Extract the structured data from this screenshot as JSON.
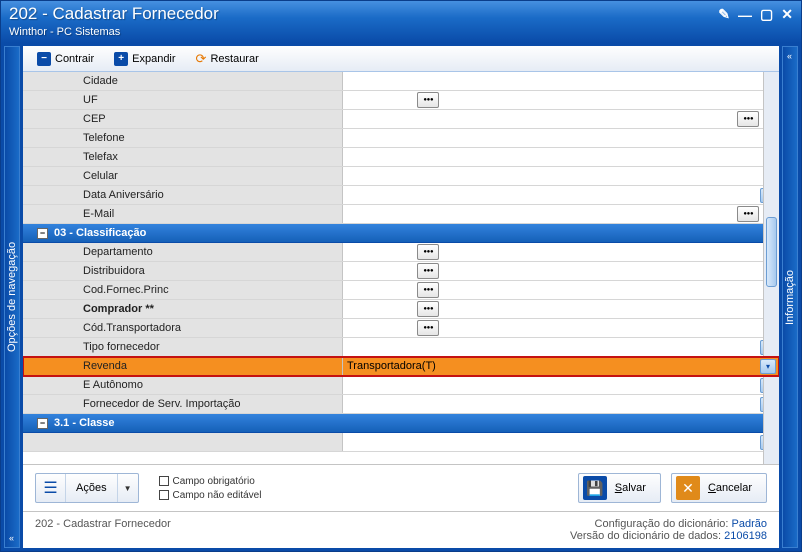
{
  "window": {
    "title": "202 - Cadastrar  Fornecedor",
    "subtitle": "Winthor - PC Sistemas"
  },
  "toolbar": {
    "contrair": "Contrair",
    "expandir": "Expandir",
    "restaurar": "Restaurar"
  },
  "sidebar_left": "Opções de navegação",
  "sidebar_right": "Informação",
  "rows_top": [
    {
      "label": "Cidade",
      "value": "",
      "ui": "none"
    },
    {
      "label": "UF",
      "value": "",
      "ui": "button"
    },
    {
      "label": "CEP",
      "value": "",
      "ui": "button-right"
    },
    {
      "label": "Telefone",
      "value": "",
      "ui": "none"
    },
    {
      "label": "Telefax",
      "value": "",
      "ui": "none"
    },
    {
      "label": "Celular",
      "value": "",
      "ui": "none"
    },
    {
      "label": "Data Aniversário",
      "value": "",
      "ui": "dropdown"
    },
    {
      "label": "E-Mail",
      "value": "",
      "ui": "button-right"
    }
  ],
  "group1": {
    "title": "03 - Classificação"
  },
  "rows_class": [
    {
      "label": "Departamento",
      "value": "",
      "ui": "button"
    },
    {
      "label": "Distribuidora",
      "value": "",
      "ui": "button"
    },
    {
      "label": "Cod.Fornec.Princ",
      "value": "",
      "ui": "button"
    },
    {
      "label": "Comprador **",
      "value": "",
      "ui": "button",
      "bold": true
    },
    {
      "label": "Cód.Transportadora",
      "value": "",
      "ui": "button"
    },
    {
      "label": "Tipo fornecedor",
      "value": "",
      "ui": "dropdown"
    },
    {
      "label": "Revenda",
      "value": "Transportadora(T)",
      "ui": "dropdown",
      "highlight": true
    },
    {
      "label": "E Autônomo",
      "value": "",
      "ui": "dropdown"
    },
    {
      "label": "Fornecedor de Serv. Importação",
      "value": "",
      "ui": "dropdown"
    }
  ],
  "group2": {
    "title": "3.1 - Classe"
  },
  "footer": {
    "acoes": "Ações",
    "legend_required": "Campo obrigatório",
    "legend_readonly": "Campo não editável",
    "salvar": "Salvar",
    "cancelar": "Cancelar"
  },
  "status": {
    "left": "202 - Cadastrar  Fornecedor",
    "config_label": "Configuração do dicionário:",
    "config_value": "Padrão",
    "version_label": "Versão do dicionário de dados:",
    "version_value": "2106198"
  }
}
